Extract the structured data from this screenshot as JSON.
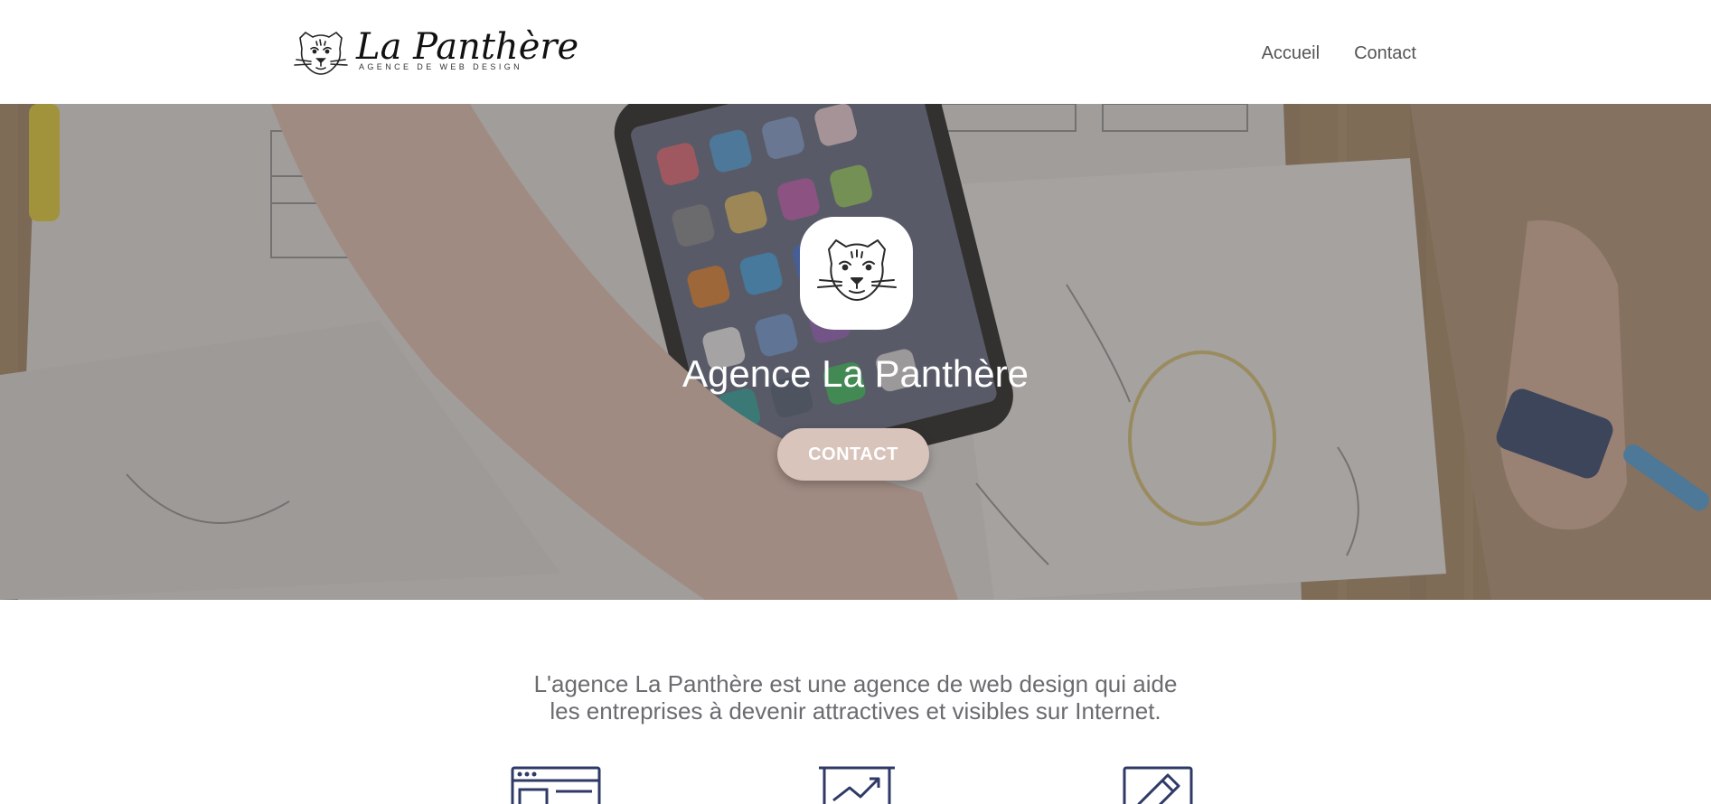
{
  "brand": {
    "name": "La Panthère",
    "tagline": "AGENCE DE WEB DESIGN"
  },
  "nav": {
    "items": [
      "Accueil",
      "Contact"
    ]
  },
  "hero": {
    "title": "Agence La Panthère",
    "button_label": "CONTACT"
  },
  "intro": {
    "line1": "L'agence La Panthère est une agence de web design qui aide",
    "line2": "les entreprises à devenir attractives et visibles sur Internet."
  },
  "features": [
    {
      "icon": "browser-window-icon"
    },
    {
      "icon": "growth-chart-icon"
    },
    {
      "icon": "pencil-edit-icon"
    }
  ],
  "colors": {
    "accent": "#d8c4bb",
    "icon_navy": "#2f3a66",
    "text_gray": "#6b6b70",
    "nav_text": "#555555"
  }
}
